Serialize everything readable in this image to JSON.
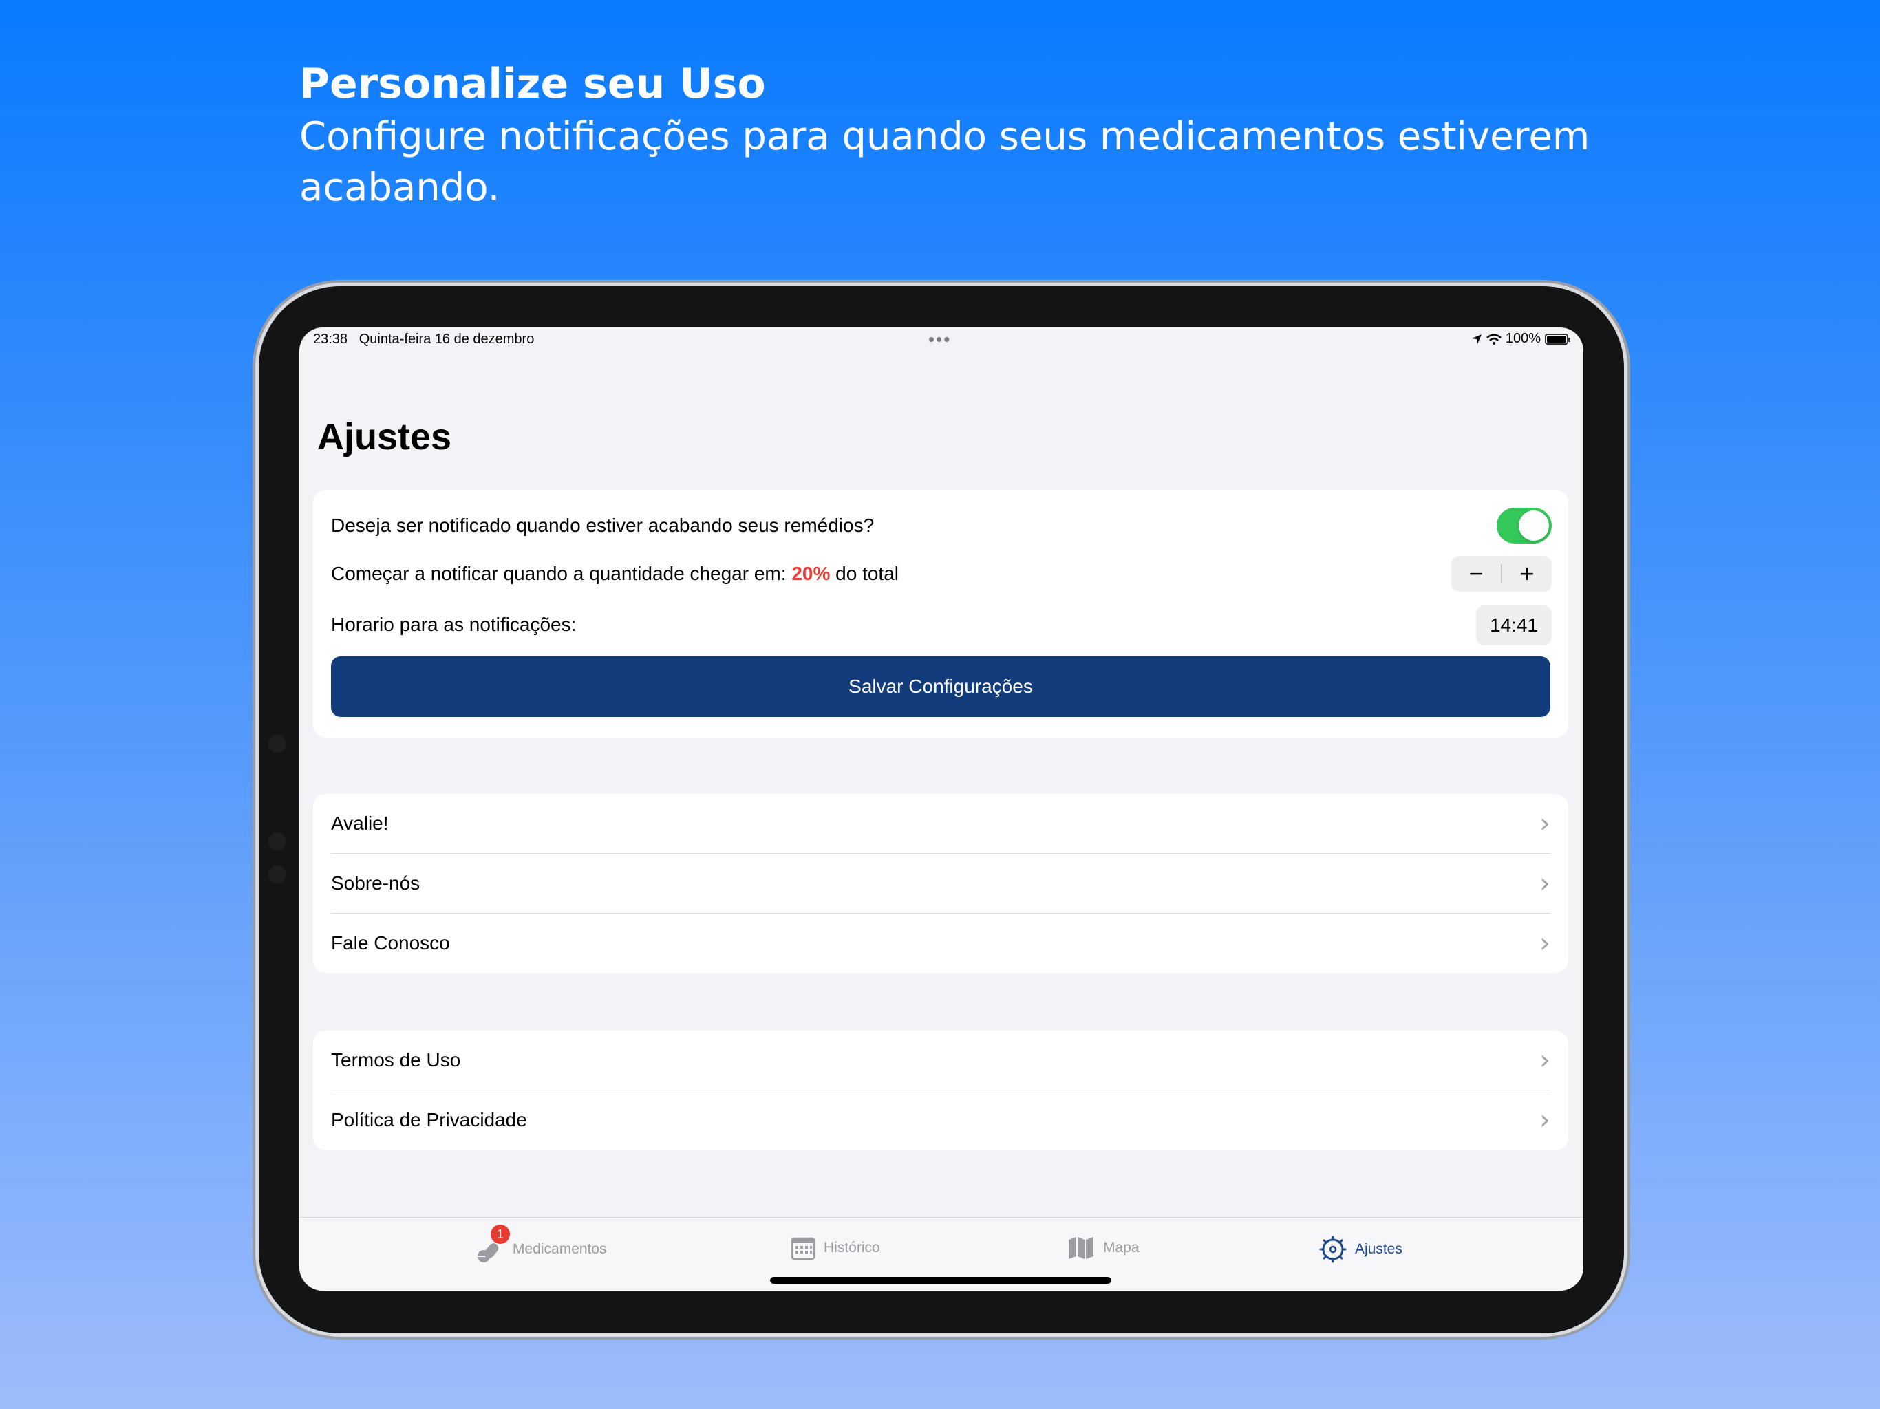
{
  "headline": {
    "title": "Personalize seu Uso",
    "subtitle": "Configure notificações para quando seus medicamentos estiverem acabando."
  },
  "status_bar": {
    "time": "23:38",
    "date": "Quinta-feira 16 de dezembro",
    "battery": "100%",
    "multitask_dots": "•••"
  },
  "page": {
    "title": "Ajustes"
  },
  "settings": {
    "notify_question": "Deseja ser notificado quando estiver acabando seus remédios?",
    "notify_enabled": true,
    "threshold_prefix": "Começar a notificar quando a quantidade chegar em:",
    "threshold_value": "20%",
    "threshold_suffix": "do total",
    "stepper_minus": "−",
    "stepper_plus": "+",
    "time_label": "Horario para as notificações:",
    "time_value": "14:41",
    "save_label": "Salvar Configurações"
  },
  "links_group1": [
    {
      "label": "Avalie!"
    },
    {
      "label": "Sobre-nós"
    },
    {
      "label": "Fale Conosco"
    }
  ],
  "links_group2": [
    {
      "label": "Termos de Uso"
    },
    {
      "label": "Política de Privacidade"
    }
  ],
  "tabs": [
    {
      "label": "Medicamentos",
      "icon": "pills-icon",
      "badge": "1"
    },
    {
      "label": "Histórico",
      "icon": "calendar-icon"
    },
    {
      "label": "Mapa",
      "icon": "map-icon"
    },
    {
      "label": "Ajustes",
      "icon": "gear-icon",
      "active": true
    }
  ],
  "colors": {
    "accent_red": "#e5433b",
    "toggle_green": "#34c759",
    "button_navy": "#133c7c",
    "tab_active": "#1e4a8a"
  }
}
